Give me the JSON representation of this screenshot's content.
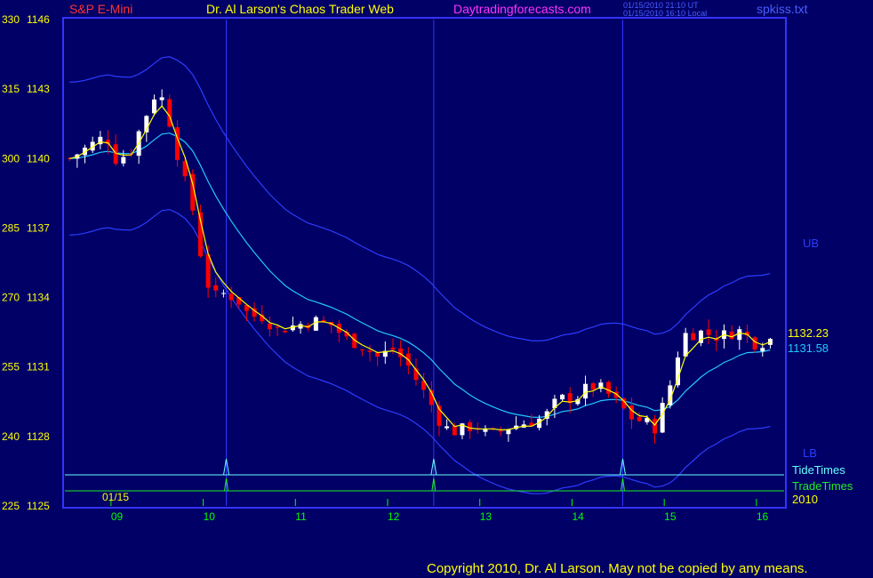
{
  "header": {
    "symbol": "S&P E-Mini",
    "title": "Dr. Al Larson's Chaos Trader Web",
    "site": "Daytradingforecasts.com",
    "stamp_ut": "01/15/2010 21:10 UT",
    "stamp_local": "01/15/2010 16:10 Local",
    "filename": "spkiss.txt"
  },
  "copyright": "Copyright 2010, Dr. Al Larson. May not be copied by any means.",
  "colors": {
    "background": "#000066",
    "frame": "#3333ff",
    "up_candle": "#ffffff",
    "down_candle": "#ff0000",
    "price_labels": "#ffff00",
    "time_labels": "#00ff00",
    "band": "#2c3cff",
    "mid_line": "#22c8ff",
    "fast_line": "#ffff00",
    "tide_line": "#66ffff",
    "trade_line": "#22ee22"
  },
  "chart_data": {
    "type": "candlestick",
    "y_ticks": [
      {
        "left": "330",
        "right": "1146",
        "value": 1146
      },
      {
        "left": "315",
        "right": "1143",
        "value": 1143
      },
      {
        "left": "300",
        "right": "1140",
        "value": 1140
      },
      {
        "left": "285",
        "right": "1137",
        "value": 1137
      },
      {
        "left": "270",
        "right": "1134",
        "value": 1134
      },
      {
        "left": "255",
        "right": "1131",
        "value": 1131
      },
      {
        "left": "240",
        "right": "1128",
        "value": 1128
      },
      {
        "left": "225",
        "right": "1125",
        "value": 1125
      }
    ],
    "ylim": [
      1125,
      1146
    ],
    "xlim": [
      8.5,
      16.3
    ],
    "x_ticks": [
      {
        "label": "09",
        "hour": 9
      },
      {
        "label": "10",
        "hour": 10
      },
      {
        "label": "11",
        "hour": 11
      },
      {
        "label": "12",
        "hour": 12
      },
      {
        "label": "13",
        "hour": 13
      },
      {
        "label": "14",
        "hour": 14
      },
      {
        "label": "15",
        "hour": 15
      },
      {
        "label": "16",
        "hour": 16
      }
    ],
    "date_label": "01/15",
    "year_label": "2010",
    "vertical_markers_hour": [
      10.25,
      12.5,
      14.55
    ],
    "price_label_fast": "1132.23",
    "price_label_mid": "1131.58",
    "band_labels": {
      "upper": "UB",
      "lower": "LB"
    },
    "lane_labels": {
      "tide": "TideTimes",
      "trade": "TradeTimes"
    },
    "anchors_close": [
      [
        8.55,
        1140.0
      ],
      [
        8.75,
        1140.5
      ],
      [
        8.95,
        1141.0
      ],
      [
        9.05,
        1140.0
      ],
      [
        9.2,
        1140.2
      ],
      [
        9.35,
        1141.6
      ],
      [
        9.5,
        1143.0
      ],
      [
        9.6,
        1142.2
      ],
      [
        9.7,
        1140.5
      ],
      [
        9.8,
        1139.0
      ],
      [
        9.9,
        1137.6
      ],
      [
        10.0,
        1135.2
      ],
      [
        10.1,
        1134.0
      ],
      [
        10.25,
        1134.2
      ],
      [
        10.4,
        1133.8
      ],
      [
        10.5,
        1133.2
      ],
      [
        10.65,
        1133.2
      ],
      [
        10.8,
        1132.6
      ],
      [
        11.0,
        1132.8
      ],
      [
        11.2,
        1133.0
      ],
      [
        11.4,
        1132.8
      ],
      [
        11.55,
        1132.2
      ],
      [
        11.7,
        1132.0
      ],
      [
        11.9,
        1131.4
      ],
      [
        12.05,
        1131.8
      ],
      [
        12.2,
        1131.2
      ],
      [
        12.35,
        1130.2
      ],
      [
        12.5,
        1129.2
      ],
      [
        12.6,
        1128.4
      ],
      [
        12.75,
        1128.2
      ],
      [
        12.95,
        1128.5
      ],
      [
        13.1,
        1128.0
      ],
      [
        13.3,
        1128.4
      ],
      [
        13.5,
        1128.6
      ],
      [
        13.7,
        1128.8
      ],
      [
        13.85,
        1129.6
      ],
      [
        14.05,
        1129.7
      ],
      [
        14.2,
        1130.2
      ],
      [
        14.35,
        1130.0
      ],
      [
        14.5,
        1129.4
      ],
      [
        14.65,
        1128.8
      ],
      [
        14.8,
        1128.6
      ],
      [
        14.9,
        1128.4
      ],
      [
        15.05,
        1130.0
      ],
      [
        15.2,
        1132.4
      ],
      [
        15.4,
        1132.5
      ],
      [
        15.6,
        1132.3
      ],
      [
        15.8,
        1132.6
      ],
      [
        16.0,
        1132.0
      ],
      [
        16.15,
        1132.2
      ]
    ],
    "ma_fast_label": "1132.23",
    "ma_mid_label": "1131.58"
  }
}
